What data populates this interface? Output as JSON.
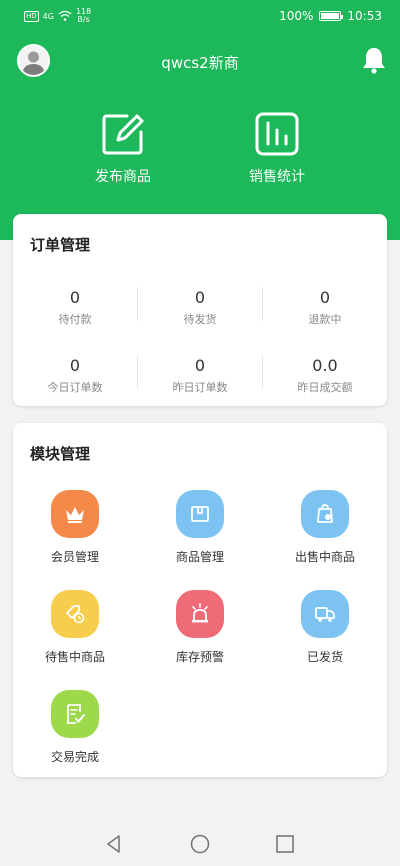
{
  "status_bar": {
    "network_badge": "HD",
    "signal": "4G",
    "speed_value": "118",
    "speed_unit": "B/s",
    "battery": "100%",
    "time": "10:53"
  },
  "header": {
    "shop_name": "qwcs2新商"
  },
  "quick_actions": [
    {
      "label": "发布商品",
      "icon": "edit-icon"
    },
    {
      "label": "销售统计",
      "icon": "bar-chart-icon"
    }
  ],
  "orders": {
    "title": "订单管理",
    "stats": [
      {
        "value": "0",
        "label": "待付款"
      },
      {
        "value": "0",
        "label": "待发货"
      },
      {
        "value": "0",
        "label": "退款中"
      },
      {
        "value": "0",
        "label": "今日订单数"
      },
      {
        "value": "0",
        "label": "昨日订单数"
      },
      {
        "value": "0.0",
        "label": "昨日成交额"
      }
    ]
  },
  "modules": {
    "title": "模块管理",
    "items": [
      {
        "label": "会员管理",
        "icon": "crown-icon",
        "color": "#f5894a"
      },
      {
        "label": "商品管理",
        "icon": "box-icon",
        "color": "#7cc3f2"
      },
      {
        "label": "出售中商品",
        "icon": "bag-icon",
        "color": "#7cc3f2"
      },
      {
        "label": "待售中商品",
        "icon": "tag-clock-icon",
        "color": "#f7cd4e"
      },
      {
        "label": "库存预警",
        "icon": "alarm-icon",
        "color": "#f06b78"
      },
      {
        "label": "已发货",
        "icon": "truck-icon",
        "color": "#7cc3f2"
      },
      {
        "label": "交易完成",
        "icon": "checklist-icon",
        "color": "#9ed84b"
      }
    ]
  },
  "colors": {
    "brand_green": "#1db85a",
    "background": "#f2f2f2"
  }
}
